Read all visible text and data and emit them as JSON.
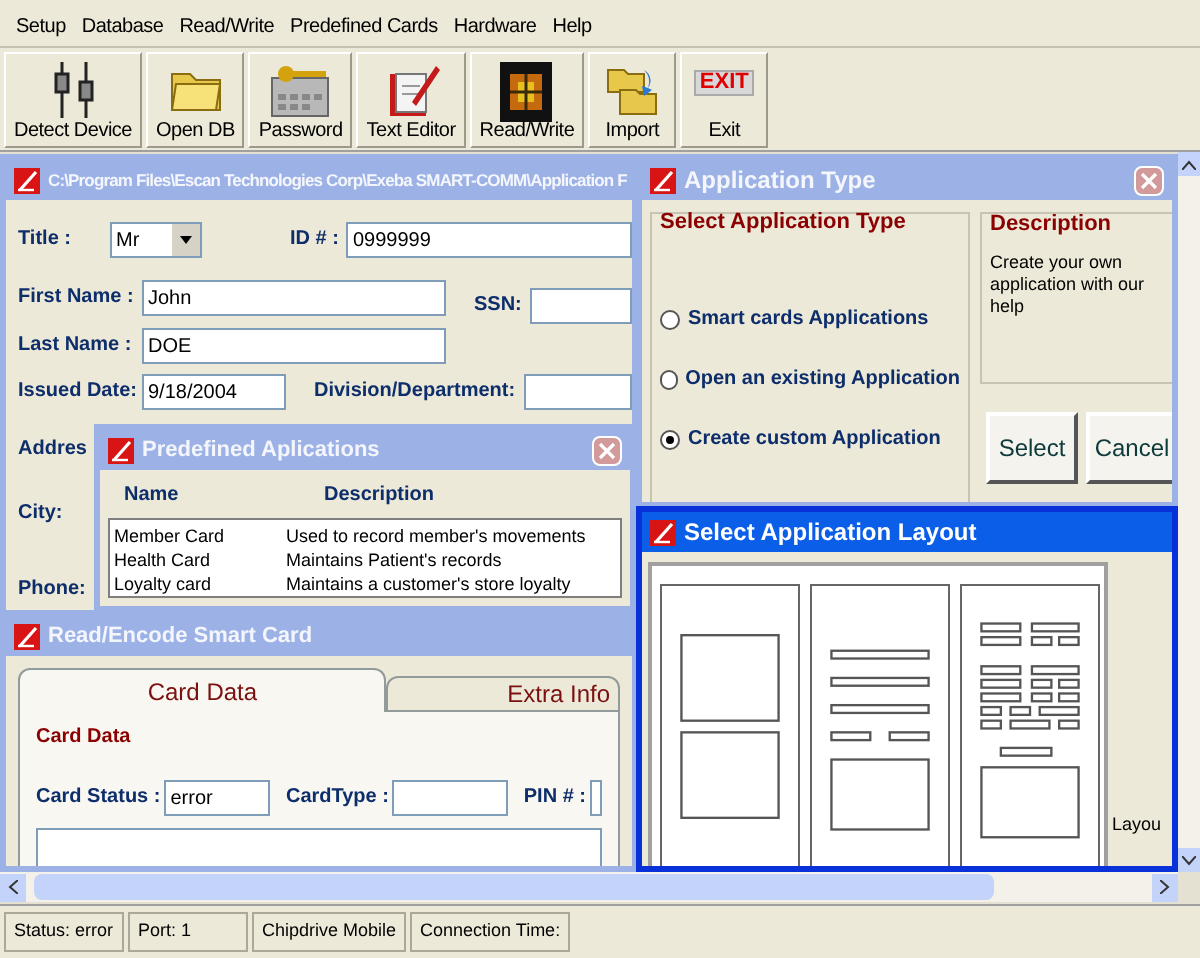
{
  "menu": [
    "Setup",
    "Database",
    "Read/Write",
    "Predefined Cards",
    "Hardware",
    "Help"
  ],
  "toolbar": [
    {
      "label": "Detect Device",
      "kind": "device"
    },
    {
      "label": "Open DB",
      "kind": "folder"
    },
    {
      "label": "Password",
      "kind": "keys"
    },
    {
      "label": "Text Editor",
      "kind": "editor"
    },
    {
      "label": "Read/Write",
      "kind": "chip"
    },
    {
      "label": "Import",
      "kind": "import"
    },
    {
      "label": "Exit",
      "kind": "exit",
      "badge": "EXIT"
    }
  ],
  "main_form": {
    "title": "C:\\Program Files\\Escan Technologies Corp\\Exeba SMART-COMM\\Application F",
    "active": false,
    "title_label": "Title :",
    "title_value": "Mr",
    "id_label": "ID # :",
    "id_value": "0999999",
    "first_name_label": "First Name :",
    "first_name": "John",
    "last_name_label": "Last Name :",
    "last_name": "DOE",
    "issued_label": "Issued Date:",
    "issued": "9/18/2004",
    "ssn_label": "SSN:",
    "division_label": "Division/Department:",
    "address_label": "Addres",
    "city_label": "City:",
    "phone_label": "Phone:"
  },
  "predefined_window": {
    "title": "Predefined Aplications",
    "active": false,
    "columns": [
      "Name",
      "Description"
    ],
    "rows": [
      {
        "name": "Member Card",
        "description": "Used to record member's movements"
      },
      {
        "name": "Health Card",
        "description": "Maintains Patient's records"
      },
      {
        "name": "Loyalty card",
        "description": "Maintains a customer's store loyalty"
      }
    ]
  },
  "read_encode_window": {
    "title": "Read/Encode Smart Card",
    "active": false,
    "tabs": [
      {
        "label": "Card Data",
        "selected": true
      },
      {
        "label": "Extra Info",
        "selected": false
      }
    ],
    "group": "Card Data",
    "card_status_label": "Card Status :",
    "card_status": "error",
    "card_type_label": "CardType :",
    "pin_label": "PIN # :"
  },
  "application_type_window": {
    "title": "Application Type",
    "active": false,
    "group": "Select Application Type",
    "options": [
      {
        "label": "Smart cards Applications",
        "selected": false
      },
      {
        "label": "Open an existing Application",
        "selected": false
      },
      {
        "label": "Create custom Application",
        "selected": true
      }
    ],
    "description_title": "Description",
    "description": "Create your own application with our help",
    "buttons": [
      "Select",
      "Cancel"
    ]
  },
  "layout_window": {
    "title": "Select Application Layout",
    "active": true,
    "layouts": [
      {
        "kind": "two-panel"
      },
      {
        "kind": "list"
      },
      {
        "kind": "grid"
      }
    ],
    "group": "Layou"
  },
  "status_bar": [
    "Status: error",
    "Port: 1",
    "Chipdrive Mobile",
    "Connection Time:"
  ]
}
